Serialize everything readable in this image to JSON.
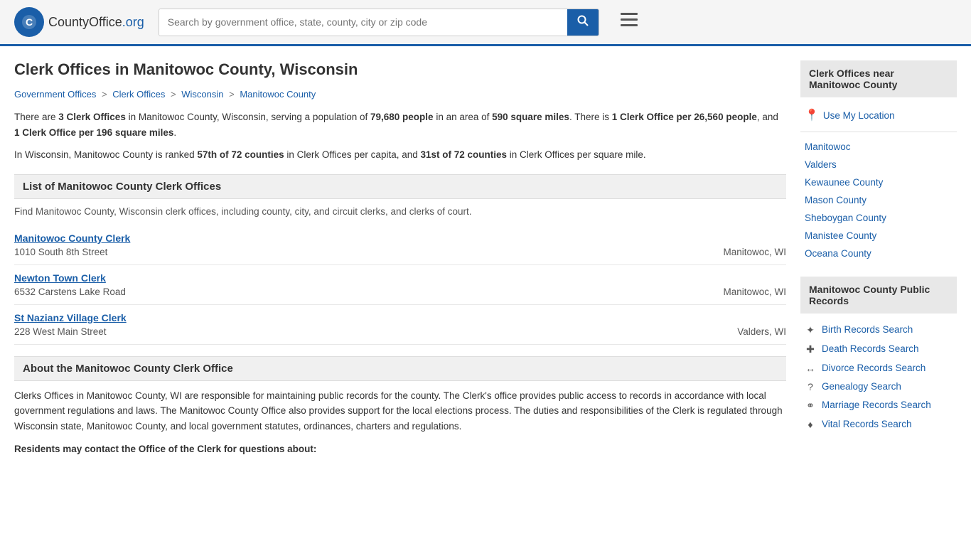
{
  "header": {
    "logo_text": "CountyOffice",
    "logo_org": ".org",
    "search_placeholder": "Search by government office, state, county, city or zip code",
    "search_icon": "🔍"
  },
  "page": {
    "title": "Clerk Offices in Manitowoc County, Wisconsin"
  },
  "breadcrumb": {
    "items": [
      {
        "label": "Government Offices",
        "href": "#"
      },
      {
        "label": "Clerk Offices",
        "href": "#"
      },
      {
        "label": "Wisconsin",
        "href": "#"
      },
      {
        "label": "Manitowoc County",
        "href": "#"
      }
    ]
  },
  "description": {
    "line1_prefix": "There are ",
    "clerk_count": "3 Clerk Offices",
    "line1_mid": " in Manitowoc County, Wisconsin, serving a population of ",
    "population": "79,680 people",
    "line1_suffix": " in an area of ",
    "area": "590 square miles",
    "line1_end": ". There is ",
    "per_capita": "1 Clerk Office per 26,560 people",
    "line1_end2": ", and ",
    "per_sqmile": "1 Clerk Office per 196 square miles",
    "rank_prefix": "In Wisconsin, Manitowoc County is ranked ",
    "rank_capita": "57th of 72 counties",
    "rank_mid": " in Clerk Offices per capita, and ",
    "rank_sqmile": "31st of 72 counties",
    "rank_suffix": " in Clerk Offices per square mile."
  },
  "list_section": {
    "header": "List of Manitowoc County Clerk Offices",
    "description": "Find Manitowoc County, Wisconsin clerk offices, including county, city, and circuit clerks, and clerks of court."
  },
  "clerks": [
    {
      "name": "Manitowoc County Clerk",
      "address": "1010 South 8th Street",
      "city": "Manitowoc, WI"
    },
    {
      "name": "Newton Town Clerk",
      "address": "6532 Carstens Lake Road",
      "city": "Manitowoc, WI"
    },
    {
      "name": "St Nazianz Village Clerk",
      "address": "228 West Main Street",
      "city": "Valders, WI"
    }
  ],
  "about_section": {
    "header": "About the Manitowoc County Clerk Office",
    "paragraph": "Clerks Offices in Manitowoc County, WI are responsible for maintaining public records for the county. The Clerk's office provides public access to records in accordance with local government regulations and laws. The Manitowoc County Office also provides support for the local elections process. The duties and responsibilities of the Clerk is regulated through Wisconsin state, Manitowoc County, and local government statutes, ordinances, charters and regulations.",
    "residents_label": "Residents may contact the Office of the Clerk for questions about:"
  },
  "sidebar": {
    "nearby_header": "Clerk Offices near Manitowoc County",
    "use_location": "Use My Location",
    "nearby_links": [
      {
        "label": "Manitowoc"
      },
      {
        "label": "Valders"
      },
      {
        "label": "Kewaunee County"
      },
      {
        "label": "Mason County"
      },
      {
        "label": "Sheboygan County"
      },
      {
        "label": "Manistee County"
      },
      {
        "label": "Oceana County"
      }
    ],
    "records_header": "Manitowoc County Public Records",
    "records_links": [
      {
        "label": "Birth Records Search",
        "icon": "✦"
      },
      {
        "label": "Death Records Search",
        "icon": "✚"
      },
      {
        "label": "Divorce Records Search",
        "icon": "↔"
      },
      {
        "label": "Genealogy Search",
        "icon": "?"
      },
      {
        "label": "Marriage Records Search",
        "icon": "⚭"
      },
      {
        "label": "Vital Records Search",
        "icon": "♦"
      }
    ]
  }
}
